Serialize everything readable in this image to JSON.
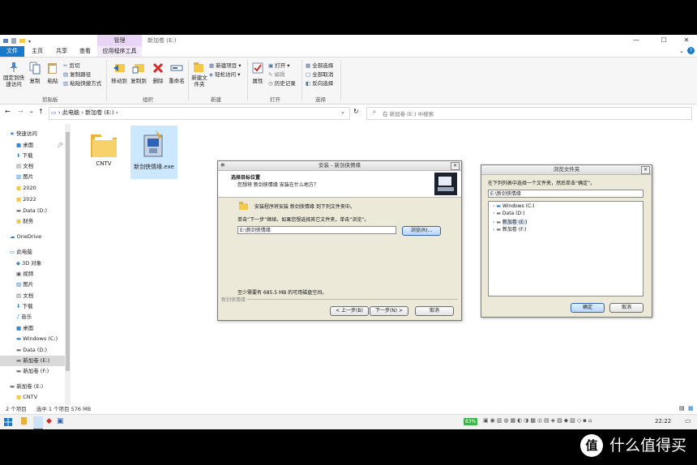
{
  "window": {
    "context_tab": "管理",
    "title": "新加卷 (E:)",
    "buttons": {
      "minimize": "—",
      "maximize": "☐",
      "close": "✕"
    }
  },
  "tabs": [
    "文件",
    "主页",
    "共享",
    "查看",
    "应用程序工具"
  ],
  "ribbon": {
    "pin_label": "固定到快速访问",
    "copy_label": "复制",
    "paste_label": "粘贴",
    "cut_label": "剪切",
    "copy_path_label": "复制路径",
    "paste_shortcut_label": "粘贴快捷方式",
    "move_to_label": "移动到",
    "copy_to_label": "复制到",
    "delete_label": "删除",
    "rename_label": "重命名",
    "new_folder_label": "新建文件夹",
    "new_item_label": "新建项目",
    "easy_access_label": "轻松访问",
    "properties_label": "属性",
    "open_label": "打开",
    "edit_label": "编辑",
    "history_label": "历史记录",
    "select_all_label": "全部选择",
    "select_none_label": "全部取消",
    "invert_label": "反向选择",
    "groups": [
      "剪贴板",
      "组织",
      "新建",
      "打开",
      "选择"
    ]
  },
  "address": {
    "crumbs": [
      "此电脑",
      "新加卷 (E:)"
    ],
    "search_placeholder": "在 新加卷 (E:) 中搜索"
  },
  "nav": {
    "quick_access": "快速访问",
    "items": [
      "桌面",
      "下载",
      "文档",
      "图片",
      "2020",
      "2022",
      "Data (D:)",
      "财务"
    ],
    "onedrive": "OneDrive",
    "this_pc": "此电脑",
    "pc_items": [
      "3D 对象",
      "视频",
      "图片",
      "文档",
      "下载",
      "音乐",
      "桌面",
      "Windows (C:)",
      "Data (D:)",
      "新加卷 (E:)",
      "新加卷 (F:)"
    ],
    "drive_e": "新加卷 (E:)",
    "cntv": "CNTV"
  },
  "files": [
    {
      "name": "CNTV"
    },
    {
      "name": "新剑侠情缘.exe"
    }
  ],
  "status": {
    "count": "2 个项目",
    "selection": "选中 1 个项目  576 MB"
  },
  "taskbar": {
    "battery": "83%",
    "time": "22:22"
  },
  "setup_dialog": {
    "title": "安装 - 新剑侠情缘",
    "heading": "选择目标位置",
    "subheading": "您想将 新剑侠情缘 安装在什么地方？",
    "line1": "安装程序将安装 新剑侠情缘 到下列文件夹中。",
    "line2": "单击“下一步”继续。如果您想选择其它文件夹，单击“浏览”。",
    "path_value": "E:\\新剑侠情缘",
    "browse_label": "浏览(R)...",
    "space_text": "至少需要有 685.5 MB 的可用磁盘空间。",
    "footer_brand": "新剑侠情缘",
    "back_label": "< 上一步(B)",
    "next_label": "下一步(N) >",
    "cancel_label": "取消"
  },
  "browse_dialog": {
    "title": "浏览文件夹",
    "prompt": "在下列列表中选择一个文件夹，然后单击“确定”。",
    "path_value": "E:\\新剑侠情缘",
    "tree": [
      "Windows (C:)",
      "Data (D:)",
      "新加卷 (E:)",
      "新加卷 (F:)"
    ],
    "ok_label": "确定",
    "cancel_label": "取消"
  },
  "brand": {
    "text": "什么值得买",
    "logo": "值"
  },
  "colors": {
    "accent": "#1979ca",
    "context_tab": "#e8d4f4",
    "folder": "#f5c84b"
  }
}
